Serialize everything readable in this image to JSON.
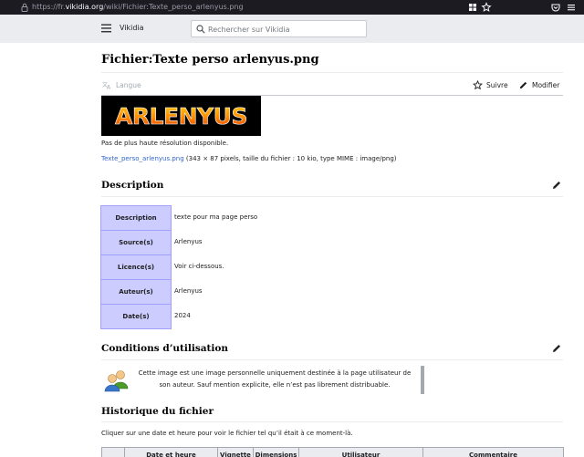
{
  "browser": {
    "url_prefix": "https://fr.",
    "url_domain": "vikidia.org",
    "url_path": "/wiki/Fichier:Texte_perso_arlenyus.png"
  },
  "header": {
    "site_name": "Vikidia",
    "search_placeholder": "Rechercher sur Vikidia"
  },
  "page": {
    "title": "Fichier:Texte perso arlenyus.png",
    "language_label": "Langue",
    "watch_label": "Suivre",
    "edit_label": "Modifier",
    "image_text": "ARLENYUS",
    "no_higher_resolution": "Pas de plus haute résolution disponible.",
    "file_link": "Texte_perso_arlenyus.png",
    "file_details": " (343 × 87 pixels, taille du fichier : 10 kio, type MIME : image/png)"
  },
  "description": {
    "heading": "Description",
    "rows": [
      {
        "label": "Description",
        "value": "texte pour ma page perso"
      },
      {
        "label": "Source(s)",
        "value": "Arlenyus"
      },
      {
        "label": "Licence(s)",
        "value": "Voir ci-dessous."
      },
      {
        "label": "Auteur(s)",
        "value": "Arlenyus"
      },
      {
        "label": "Date(s)",
        "value": "2024"
      }
    ]
  },
  "conditions": {
    "heading": "Conditions d’utilisation",
    "notice_line1": "Cette image est une image personnelle uniquement destinée à la page utilisateur de",
    "notice_line2": "son auteur. Sauf mention explicite, elle n’est pas librement distribuable."
  },
  "history": {
    "heading": "Historique du fichier",
    "intro": "Cliquer sur une date et heure pour voir le fichier tel qu’il était à ce moment-là.",
    "columns": [
      "",
      "Date et heure",
      "Vignette",
      "Dimensions",
      "Utilisateur",
      "Commentaire"
    ]
  },
  "colors": {
    "table_header_bg": "#ccccff",
    "table_header_border": "#a0a0ff",
    "link": "#3366cc",
    "browser_bar": "#1c1b22",
    "site_header_bg": "#eaecf0"
  }
}
